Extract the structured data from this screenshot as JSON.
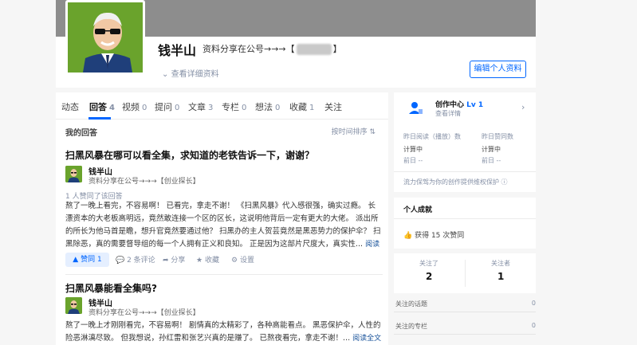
{
  "profile": {
    "name": "钱半山",
    "headline_prefix": "资料分享在公号→→→【",
    "headline_suffix": "】",
    "detail_link": "查看详细资料",
    "edit_button": "编辑个人资料"
  },
  "tabs": [
    {
      "label": "动态",
      "count": ""
    },
    {
      "label": "回答",
      "count": "4"
    },
    {
      "label": "视频",
      "count": "0"
    },
    {
      "label": "提问",
      "count": "0"
    },
    {
      "label": "文章",
      "count": "3"
    },
    {
      "label": "专栏",
      "count": "0"
    },
    {
      "label": "想法",
      "count": "0"
    },
    {
      "label": "收藏",
      "count": "1"
    },
    {
      "label": "关注",
      "count": ""
    }
  ],
  "answers_section": {
    "title": "我的回答",
    "sort": "按时间排序"
  },
  "answers": [
    {
      "question": "扫黑风暴在哪可以看全集，求知道的老铁告诉一下，谢谢？",
      "author": "钱半山",
      "author_headline": "资料分享在公号→→→【创业探长】",
      "voters": "1 人赞同了该回答",
      "excerpt": "熬了一晚上看完，不容易啊！ 已看完，拿走不谢！ 《扫黑风暴》代入感很强，确实过瘾。 长漂资本的大老板高明远，竟然敢连接一个区的区长，这说明他背后一定有更大的大佬。 派出所的所长为他马首是瞻，想升官竟然要通过他？ 扫黑办的主人贺芸竟然是黑恶势力的保护伞？ 扫黑除恶，真的需要督导组的每一个人拥有正义和良知。 正是因为这部片尺度大，真实性...",
      "read_more": "阅读全文",
      "vote": "赞同 1",
      "comments": "2 条评论",
      "share": "分享",
      "favorite": "收藏",
      "settings": "设置"
    },
    {
      "question": "扫黑风暴能看全集吗?",
      "author": "钱半山",
      "author_headline": "资料分享在公号→→→【创业探长】",
      "excerpt": "熬了一晚上才刚刚看完，不容易啊！ 剧情真的太精彩了，各种高能看点。 黑恶保护伞，人性的险恶淋漓尽致。 但我想说，孙红雷和张艺兴真的是赚了。 已熬夜看完，拿走不谢！...",
      "read_more": "阅读全文"
    }
  ],
  "creator": {
    "title": "创作中心",
    "level": "Lv 1",
    "detail": "查看详情",
    "yesterday_reads_label": "昨日阅读（播放）数",
    "yesterday_votes_label": "昨日赞同数",
    "calc_status_1": "计算中",
    "calc_status_2": "计算中",
    "prev_day_1": "前日 --",
    "prev_day_2": "前日 --",
    "promo": "流力保驾为你的创作提供维权保护"
  },
  "achievements": {
    "title": "个人成就",
    "votes": "获得 15 次赞同"
  },
  "follow": {
    "following_label": "关注了",
    "following_count": "2",
    "followers_label": "关注者",
    "followers_count": "1"
  },
  "side_list": [
    {
      "label": "关注的话题",
      "count": "0"
    },
    {
      "label": "关注的专栏",
      "count": "0"
    }
  ],
  "colors": {
    "accent": "#0066ff",
    "avatar_bg": "#6aa32c",
    "cover": "#8d8d8d"
  }
}
